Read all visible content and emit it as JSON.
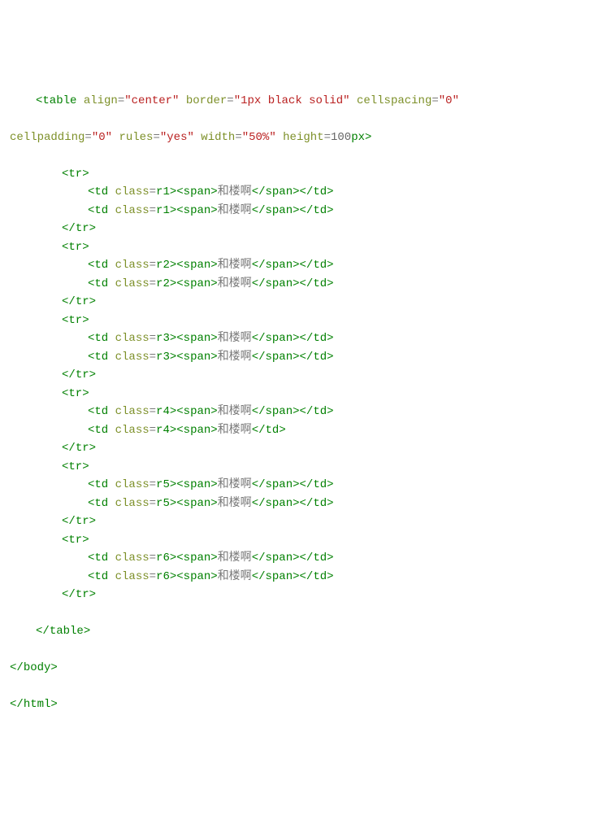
{
  "code": {
    "table_open_1": {
      "tag": "table",
      "align_attr": "align",
      "align_val": "\"center\"",
      "border_attr": "border",
      "border_val": "\"1px black solid\"",
      "cellspacing_attr": "cellspacing",
      "cellspacing_val": "\"0\""
    },
    "table_open_2": {
      "cellpadding_attr": "cellpadding",
      "cellpadding_val": "\"0\"",
      "rules_attr": "rules",
      "rules_val": "\"yes\"",
      "width_attr": "width",
      "width_val": "\"50%\"",
      "height_attr": "height",
      "height_num": "100",
      "height_unit": "px"
    },
    "tr_open": "tr",
    "tr_close": "tr",
    "td_tag": "td",
    "class_attr": "class",
    "span_tag": "span",
    "content": "和楼啊",
    "rows": [
      {
        "cls": "r1"
      },
      {
        "cls": "r2"
      },
      {
        "cls": "r3"
      },
      {
        "cls": "r4"
      },
      {
        "cls": "r5"
      },
      {
        "cls": "r6"
      }
    ],
    "table_close": "table",
    "body_close": "body",
    "html_close": "html"
  }
}
